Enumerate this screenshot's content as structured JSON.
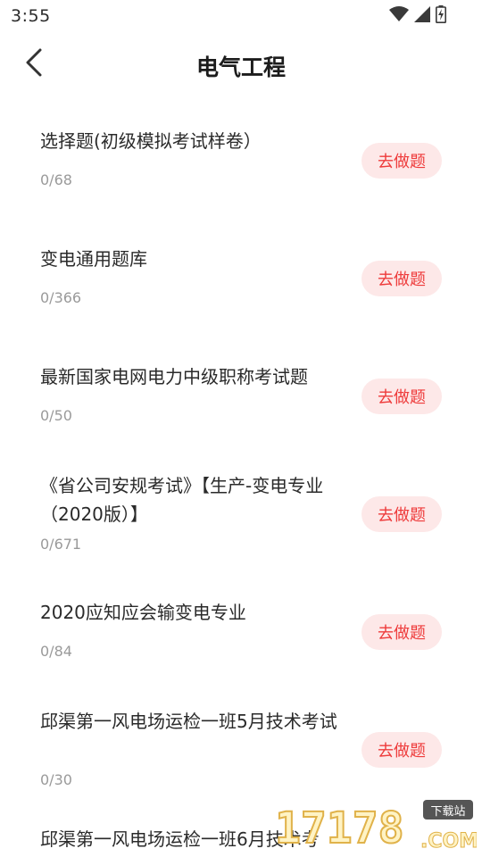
{
  "status_bar": {
    "time": "3:55",
    "icons": [
      "wifi-icon",
      "signal-icon",
      "battery-charging-icon"
    ]
  },
  "header": {
    "back_icon": "chevron-left-icon",
    "title": "电气工程"
  },
  "items": [
    {
      "title": "选择题(初级模拟考试样卷）",
      "progress": "0/68",
      "action": "去做题"
    },
    {
      "title": "变电通用题库",
      "progress": "0/366",
      "action": "去做题"
    },
    {
      "title": "最新国家电网电力中级职称考试题",
      "progress": "0/50",
      "action": "去做题"
    },
    {
      "title": "《省公司安规考试》【生产-变电专业（2020版）】",
      "progress": "0/671",
      "action": "去做题"
    },
    {
      "title": "2020应知应会输变电专业",
      "progress": "0/84",
      "action": "去做题"
    },
    {
      "title": "邱渠第一风电场运检一班5月技术考试",
      "progress": "0/30",
      "action": "去做题"
    },
    {
      "title": "邱渠第一风电场运检一班6月技术考",
      "progress": "",
      "action": ""
    }
  ],
  "watermark": {
    "number": "17178",
    "badge": "下载站",
    "domain": ".COM"
  },
  "colors": {
    "accent": "#ee3b3b",
    "button_bg": "#fde8e8",
    "muted": "#9a9a9a"
  }
}
